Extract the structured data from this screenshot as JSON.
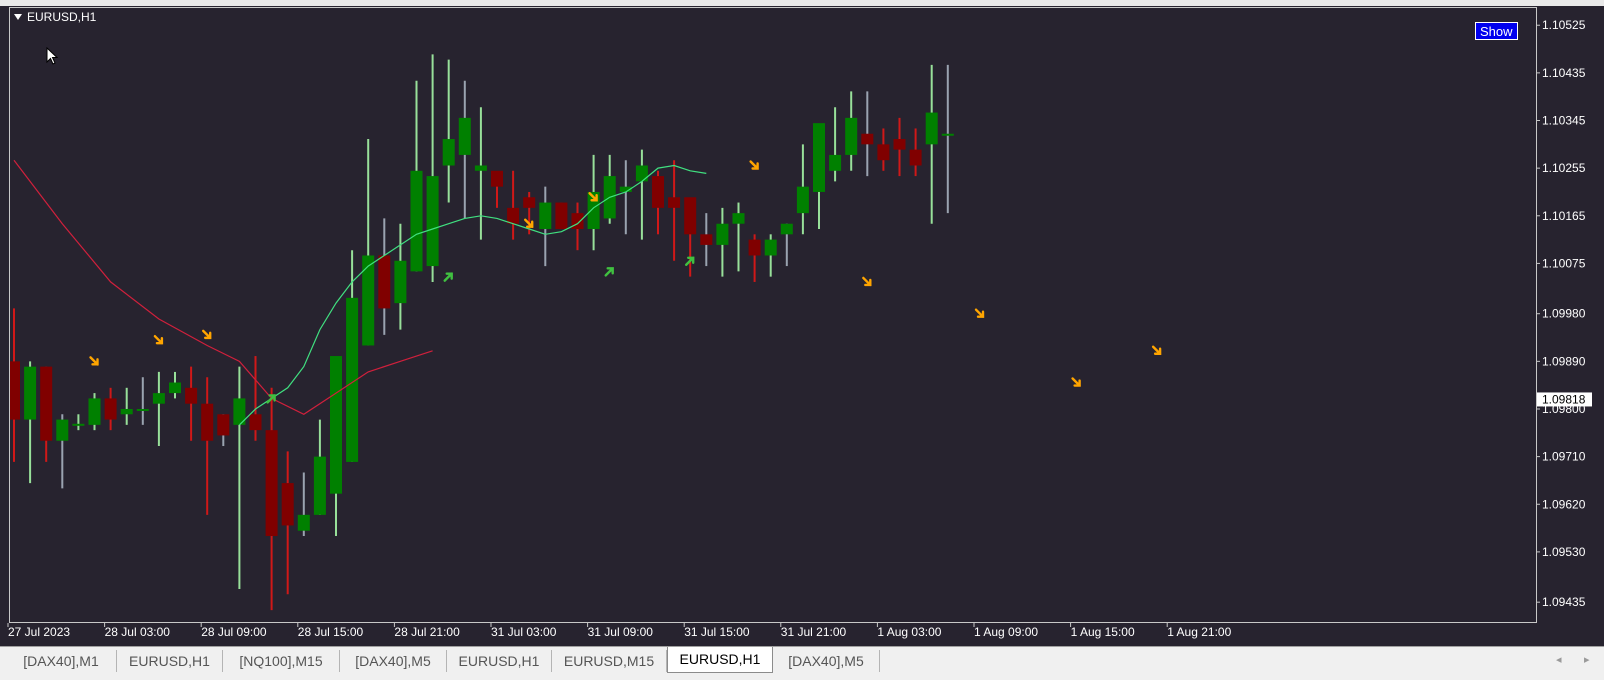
{
  "window": {
    "symbol_title": "EURUSD,H1",
    "show_button_label": "Show",
    "current_price_label": "1.09818"
  },
  "icons": {
    "collapse": "triangle-down-icon",
    "cursor": "mouse-pointer-icon",
    "tab_scroll_left": "◂",
    "tab_scroll_right": "▸"
  },
  "colors": {
    "background": "#27232f",
    "bull_body": "#008000",
    "bear_body": "#800000",
    "bull_wick": "#98e09a",
    "bear_wick": "#d01818",
    "neutral_wick": "#9aa3b0",
    "fast_ma": "#40e080",
    "slow_ma": "#d0203c",
    "sell_arrow": "#ffa500",
    "buy_arrow": "#40c040"
  },
  "tabs": [
    {
      "label": "[DAX40],M1",
      "active": false
    },
    {
      "label": "EURUSD,H1",
      "active": false
    },
    {
      "label": "[NQ100],M15",
      "active": false
    },
    {
      "label": "[DAX40],M5",
      "active": false
    },
    {
      "label": "EURUSD,H1",
      "active": false
    },
    {
      "label": "EURUSD,M15",
      "active": false
    },
    {
      "label": "EURUSD,H1",
      "active": true
    },
    {
      "label": "[DAX40],M5",
      "active": false
    }
  ],
  "chart_data": {
    "type": "candlestick",
    "symbol": "EURUSD",
    "timeframe": "H1",
    "ylim": [
      1.0939,
      1.1055
    ],
    "y_ticks": [
      "1.10525",
      "1.10435",
      "1.10345",
      "1.10255",
      "1.10165",
      "1.10075",
      "1.09980",
      "1.09890",
      "1.09800",
      "1.09710",
      "1.09620",
      "1.09530",
      "1.09435"
    ],
    "y_tick_values": [
      1.10525,
      1.10435,
      1.10345,
      1.10255,
      1.10165,
      1.10075,
      1.0998,
      1.0989,
      1.098,
      1.0971,
      1.0962,
      1.0953,
      1.09435
    ],
    "current_price": 1.09818,
    "x_ticks": [
      {
        "label": "27 Jul 2023",
        "bar": 0
      },
      {
        "label": "28 Jul 03:00",
        "bar": 6
      },
      {
        "label": "28 Jul 09:00",
        "bar": 12
      },
      {
        "label": "28 Jul 15:00",
        "bar": 18
      },
      {
        "label": "28 Jul 21:00",
        "bar": 24
      },
      {
        "label": "31 Jul 03:00",
        "bar": 30
      },
      {
        "label": "31 Jul 09:00",
        "bar": 36
      },
      {
        "label": "31 Jul 15:00",
        "bar": 42
      },
      {
        "label": "31 Jul 21:00",
        "bar": 48
      },
      {
        "label": "1 Aug 03:00",
        "bar": 54
      },
      {
        "label": "1 Aug 09:00",
        "bar": 60
      },
      {
        "label": "1 Aug 15:00",
        "bar": 66
      },
      {
        "label": "1 Aug 21:00",
        "bar": 72
      }
    ],
    "candles": [
      [
        1.0989,
        1.0978,
        1.0999,
        1.097
      ],
      [
        1.0978,
        1.0988,
        1.0989,
        1.0966
      ],
      [
        1.0988,
        1.0974,
        1.0988,
        1.097
      ],
      [
        1.0974,
        1.0978,
        1.0979,
        1.0965
      ],
      [
        1.0977,
        1.09772,
        1.0979,
        1.0976
      ],
      [
        1.0977,
        1.0982,
        1.0983,
        1.0976
      ],
      [
        1.0982,
        1.0978,
        1.0984,
        1.0976
      ],
      [
        1.0979,
        1.098,
        1.0984,
        1.0977
      ],
      [
        1.098,
        1.098,
        1.0986,
        1.0977
      ],
      [
        1.0981,
        1.0983,
        1.0987,
        1.0973
      ],
      [
        1.0983,
        1.0985,
        1.0987,
        1.0982
      ],
      [
        1.0984,
        1.0981,
        1.0988,
        1.0974
      ],
      [
        1.0981,
        1.0974,
        1.0986,
        1.096
      ],
      [
        1.0979,
        1.0975,
        1.0979,
        1.0973
      ],
      [
        1.0977,
        1.0982,
        1.0988,
        1.0946
      ],
      [
        1.0979,
        1.0976,
        1.099,
        1.0974
      ],
      [
        1.0976,
        1.0956,
        1.0984,
        1.0942
      ],
      [
        1.0966,
        1.0958,
        1.0972,
        1.0945
      ],
      [
        1.0957,
        1.096,
        1.0968,
        1.0956
      ],
      [
        1.096,
        1.0971,
        1.0978,
        1.096
      ],
      [
        1.0964,
        1.099,
        1.0988,
        1.0956
      ],
      [
        1.097,
        1.1001,
        1.101,
        1.097
      ],
      [
        1.0992,
        1.1009,
        1.1031,
        1.0992
      ],
      [
        1.1009,
        1.0999,
        1.1016,
        1.0994
      ],
      [
        1.1,
        1.1008,
        1.1015,
        1.0995
      ],
      [
        1.1006,
        1.1025,
        1.1042,
        1.1006
      ],
      [
        1.1007,
        1.1024,
        1.1047,
        1.1004
      ],
      [
        1.1026,
        1.1031,
        1.1046,
        1.1019
      ],
      [
        1.1028,
        1.1035,
        1.1042,
        1.1016
      ],
      [
        1.1025,
        1.1026,
        1.1037,
        1.1012
      ],
      [
        1.1025,
        1.1022,
        1.1024,
        1.1018
      ],
      [
        1.1018,
        1.1015,
        1.1025,
        1.1012
      ],
      [
        1.102,
        1.1018,
        1.1021,
        1.1013
      ],
      [
        1.1014,
        1.1019,
        1.1022,
        1.1007
      ],
      [
        1.1019,
        1.1014,
        1.1019,
        1.1014
      ],
      [
        1.1017,
        1.1014,
        1.1019,
        1.101
      ],
      [
        1.1014,
        1.1021,
        1.1028,
        1.101
      ],
      [
        1.1016,
        1.1024,
        1.1028,
        1.1015
      ],
      [
        1.1021,
        1.1022,
        1.1027,
        1.1013
      ],
      [
        1.1023,
        1.1026,
        1.1029,
        1.1012
      ],
      [
        1.1024,
        1.1018,
        1.1025,
        1.1013
      ],
      [
        1.102,
        1.1018,
        1.1027,
        1.1008
      ],
      [
        1.102,
        1.1013,
        1.1019,
        1.1005
      ],
      [
        1.1013,
        1.1011,
        1.1017,
        1.1007
      ],
      [
        1.1011,
        1.1015,
        1.1018,
        1.1005
      ],
      [
        1.1015,
        1.1017,
        1.1019,
        1.1006
      ],
      [
        1.1012,
        1.1009,
        1.1013,
        1.1004
      ],
      [
        1.1009,
        1.1012,
        1.1013,
        1.1005
      ],
      [
        1.1013,
        1.1015,
        1.1015,
        1.1007
      ],
      [
        1.1017,
        1.1022,
        1.103,
        1.1013
      ],
      [
        1.1021,
        1.1034,
        1.1032,
        1.1014
      ],
      [
        1.1025,
        1.1028,
        1.1037,
        1.1023
      ],
      [
        1.1028,
        1.1035,
        1.104,
        1.1025
      ],
      [
        1.1032,
        1.103,
        1.104,
        1.1024
      ],
      [
        1.103,
        1.1027,
        1.1033,
        1.1025
      ],
      [
        1.1031,
        1.1029,
        1.1035,
        1.1024
      ],
      [
        1.1029,
        1.1026,
        1.1033,
        1.1024
      ],
      [
        1.103,
        1.1036,
        1.1045,
        1.1015
      ],
      [
        1.1032,
        1.1032,
        1.1045,
        1.1017
      ]
    ],
    "ma_fast": [
      [
        14,
        1.0977
      ],
      [
        15,
        1.098
      ],
      [
        16,
        1.0982
      ],
      [
        17,
        1.0984
      ],
      [
        18,
        1.0988
      ],
      [
        19,
        1.0995
      ],
      [
        20,
        1.1
      ],
      [
        21,
        1.1004
      ],
      [
        22,
        1.1007
      ],
      [
        23,
        1.1009
      ],
      [
        24,
        1.1011
      ],
      [
        25,
        1.1013
      ],
      [
        26,
        1.1014
      ],
      [
        27,
        1.1015
      ],
      [
        28,
        1.1016
      ],
      [
        29,
        1.10165
      ],
      [
        30,
        1.1016
      ],
      [
        31,
        1.1015
      ],
      [
        32,
        1.1014
      ],
      [
        33,
        1.1013
      ],
      [
        34,
        1.10135
      ],
      [
        35,
        1.1015
      ],
      [
        36,
        1.1018
      ],
      [
        37,
        1.102
      ],
      [
        38,
        1.1021
      ],
      [
        39,
        1.1023
      ],
      [
        40,
        1.10255
      ],
      [
        41,
        1.1026
      ],
      [
        42,
        1.1025
      ],
      [
        43,
        1.10245
      ]
    ],
    "ma_slow": [
      [
        0,
        1.1027
      ],
      [
        3,
        1.1015
      ],
      [
        6,
        1.1004
      ],
      [
        9,
        1.0997
      ],
      [
        12,
        1.0992
      ],
      [
        14,
        1.0989
      ],
      [
        16,
        1.0982
      ],
      [
        18,
        1.0979
      ],
      [
        20,
        1.0983
      ],
      [
        22,
        1.0987
      ],
      [
        24,
        1.0989
      ],
      [
        26,
        1.0991
      ]
    ],
    "sell_signals": [
      [
        5,
        1.0989
      ],
      [
        9,
        1.0993
      ],
      [
        12,
        1.0994
      ],
      [
        32,
        1.1015
      ],
      [
        36,
        1.102
      ],
      [
        46,
        1.1026
      ],
      [
        53,
        1.1004
      ],
      [
        60,
        1.0998
      ],
      [
        66,
        1.0985
      ],
      [
        71,
        1.0991
      ]
    ],
    "buy_signals": [
      [
        27,
        1.1005
      ],
      [
        37,
        1.1006
      ],
      [
        42,
        1.1008
      ],
      [
        16,
        1.0982
      ]
    ]
  }
}
